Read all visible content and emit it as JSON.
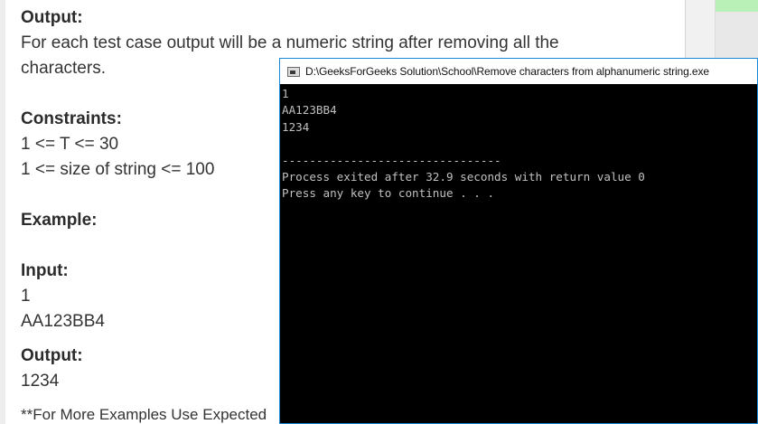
{
  "problem": {
    "output_heading": "Output:",
    "output_text_1": " For each test case output will be a numeric string after removing all the",
    "output_text_2": "characters.",
    "constraints_heading": "Constraints:",
    "constraint_1": "1 <= T <= 30",
    "constraint_2": "1 <= size of string <= 100",
    "example_heading": "Example:",
    "input_heading": "Input:",
    "input_line_1": "1",
    "input_line_2": "AA123BB4",
    "example_output_heading": "Output:",
    "example_output_line": "1234",
    "note": "**For More Examples Use Expected"
  },
  "console": {
    "title": "D:\\GeeksForGeeks Solution\\School\\Remove characters from alphanumeric string.exe",
    "icon": "console-app-icon",
    "lines": [
      "1",
      "AA123BB4",
      "1234",
      "",
      "--------------------------------",
      "Process exited after 32.9 seconds with return value 0",
      "Press any key to continue . . ."
    ]
  },
  "colors": {
    "console_bg": "#000000",
    "console_text": "#c0c0c0",
    "console_border": "#1b88d6",
    "accent_green": "#b8f0b8"
  }
}
